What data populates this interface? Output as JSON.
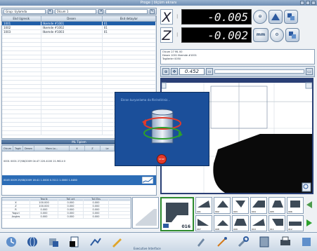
{
  "window": {
    "title": "Proge | ölçüm ekranı"
  },
  "toolbar": {
    "field1": "Grup: Uylamda",
    "field2": "Olcum 1",
    "field3": ""
  },
  "main_table": {
    "headers": [
      "Ekd Ugresik",
      "Desen",
      "Ekd detaylar"
    ],
    "rows": [
      [
        "1001",
        "Ilkemde #1001",
        "01"
      ],
      [
        "1002",
        "Ilkemde #1002",
        "01"
      ],
      [
        "1003",
        "Ilkemde #1003",
        "01"
      ]
    ]
  },
  "sub_title": "ML Tiplem",
  "sub_table": {
    "headers": [
      "Olcum",
      "Tagki",
      "Desen",
      "Mara Lo...",
      "X",
      "Z",
      "Le"
    ],
    "rows": [
      {
        "text": "0001   0001          27/08/2009 04:47  220.4100  21.9614  0",
        "selected": false
      },
      {
        "text": "0045  0009          29/08/2009 16:41  1.0000  0.3111  1.0000  1.0480",
        "selected": true
      }
    ]
  },
  "readout": {
    "x_axis": "X",
    "z_axis": "Z",
    "x_value": "-0.005",
    "z_value": "-0.002",
    "mm_label": "mm"
  },
  "info": {
    "line1": "Olcum 27   ML 00",
    "line2": "Desen 1001   Ilkemde #1001",
    "line3": "Tagilerler 0050"
  },
  "zoom": {
    "value": "0.452"
  },
  "dialog": {
    "title": "Ekran kuryonlama da fikrindiriniz...",
    "stop_label": "STOP"
  },
  "bottom_table": {
    "headers": [
      "",
      "Teorik",
      "Toll art",
      "Toll Eks",
      ""
    ],
    "rows": [
      [
        "X",
        "100.000",
        "0.000",
        "0.000",
        ""
      ],
      [
        "Z",
        "100.000",
        "0.000",
        "0.000",
        ""
      ],
      [
        "R",
        "0.000",
        "0.000",
        "0.000",
        ""
      ],
      [
        "Yaguri",
        "0.000",
        "0.000",
        "0.000",
        ""
      ],
      [
        "Angles",
        "0.000",
        "0.000",
        "0.000",
        ""
      ]
    ]
  },
  "big_thumb": {
    "number": "016"
  },
  "thumbs": [
    "001",
    "002",
    "003",
    "004",
    "005",
    "006",
    "007",
    "008",
    "009",
    "010",
    "011",
    "012"
  ],
  "taskbar": {
    "label": "Executive Interface"
  },
  "colors": {
    "accent": "#1f5ea8",
    "lcd": "#000000",
    "viewer_border": "#2a3f75"
  }
}
